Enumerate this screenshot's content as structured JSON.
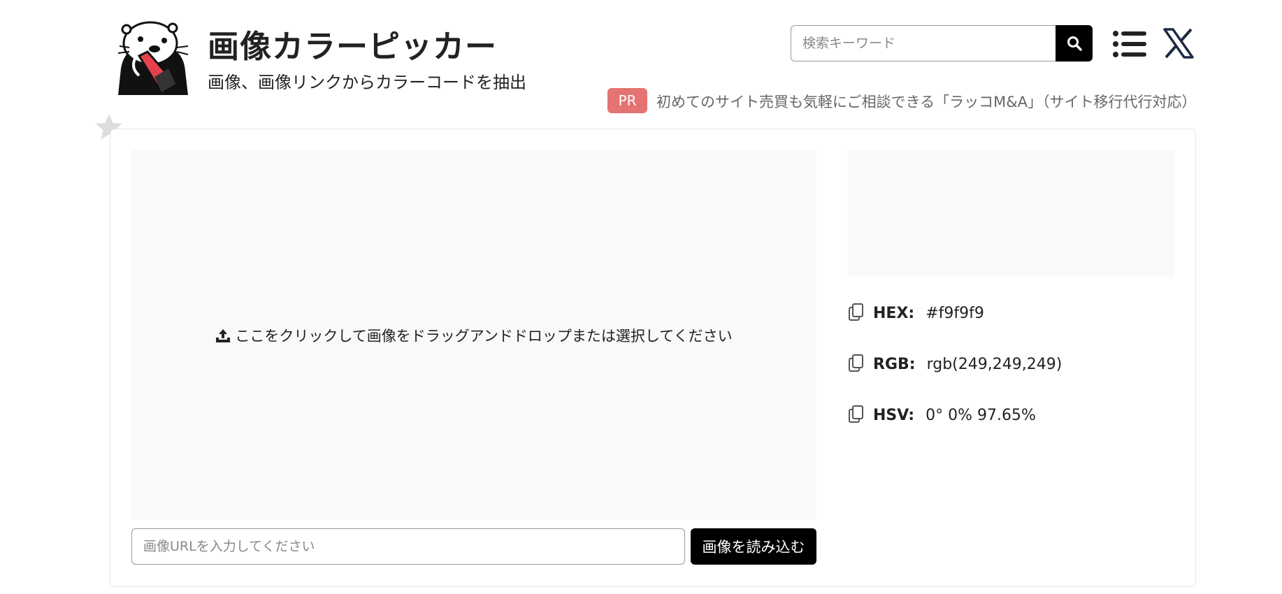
{
  "header": {
    "title": "画像カラーピッカー",
    "subtitle": "画像、画像リンクからカラーコードを抽出",
    "search_placeholder": "検索キーワード",
    "pr_badge": "PR",
    "pr_text": "初めてのサイト売買も気軽にご相談できる「ラッコM&A」（サイト移行代行対応）",
    "icons": [
      "search-icon",
      "menu-icon",
      "x-logo-icon",
      "star-icon",
      "otter-logo"
    ]
  },
  "picker": {
    "dropzone_text": "ここをクリックして画像をドラッグアンドドロップまたは選択してください",
    "url_placeholder": "画像URLを入力してください",
    "load_button": "画像を読み込む"
  },
  "color_info": {
    "swatch_color": "#f9f9f9",
    "hex_label": "HEX:",
    "hex_value": "#f9f9f9",
    "rgb_label": "RGB:",
    "rgb_value": "rgb(249,249,249)",
    "hsv_label": "HSV:",
    "hsv_value": "0° 0% 97.65%"
  },
  "colors": {
    "pr_badge_bg": "#e57373",
    "button_bg": "#000000",
    "panel_bg": "#f9f9f9",
    "logo_accent": "#e8414d"
  }
}
